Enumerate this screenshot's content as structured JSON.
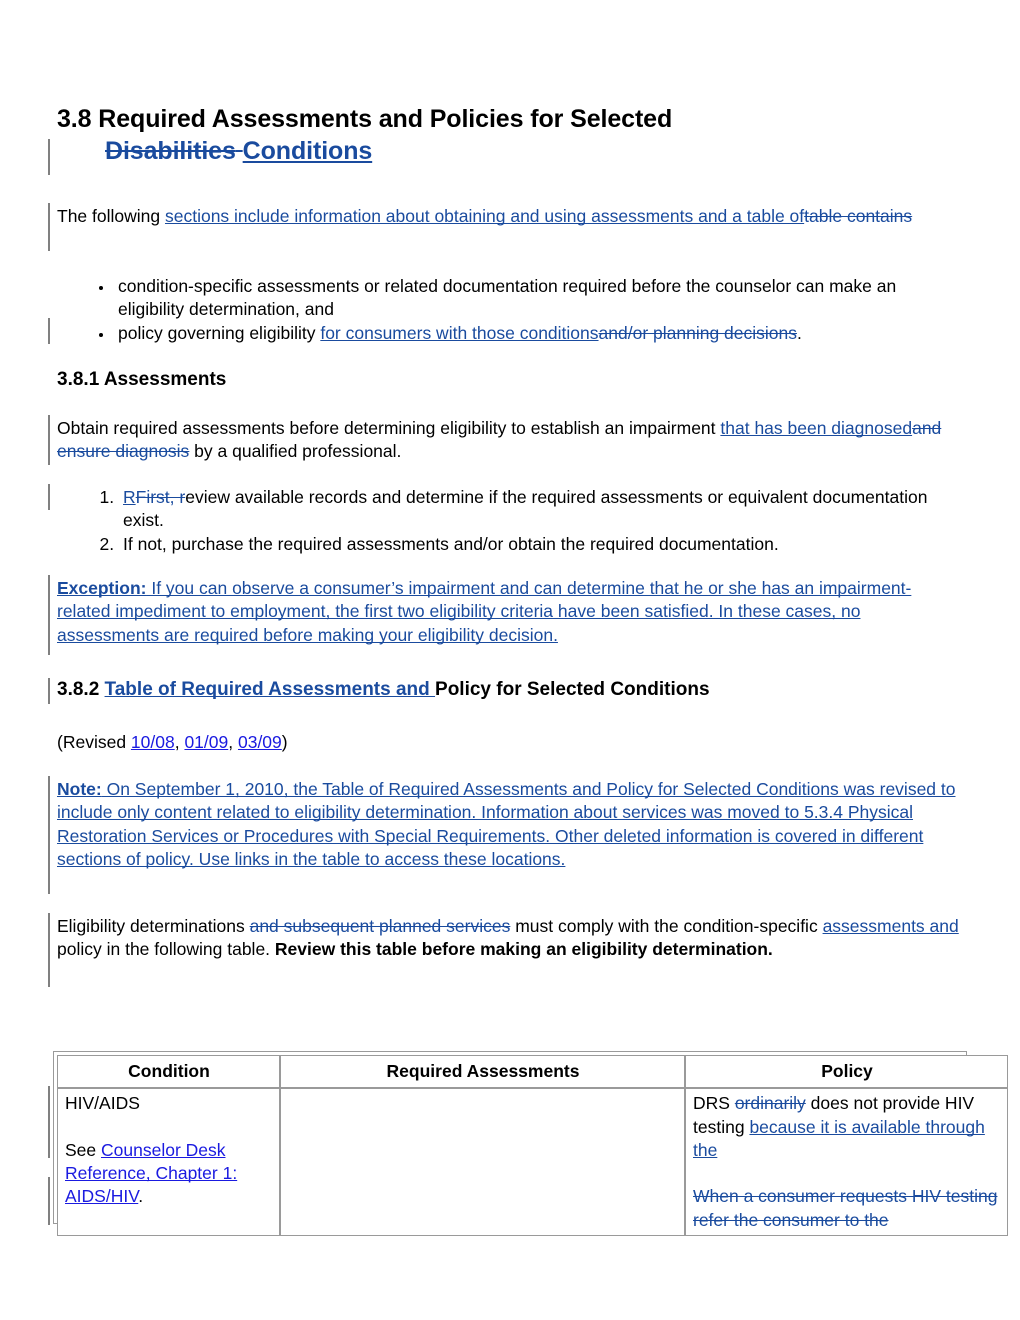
{
  "document": {
    "heading": {
      "number": "3.8",
      "line1": "3.8 Required Assessments and Policies for Selected",
      "line2_deleted": "Disabilities",
      "line2_inserted": "Conditions"
    },
    "intro": {
      "lead": "The following ",
      "inserted": "sections include information about obtaining and using assessments and a table of",
      "deleted": "table contains"
    },
    "bullets": [
      {
        "text": "condition-specific assessments or related documentation required before the counselor can make an eligibility determination, and"
      },
      {
        "lead": "policy governing eligibility ",
        "inserted": "for consumers with those conditions",
        "deleted": "and/or planning decisions",
        "tail": "."
      }
    ],
    "section_381": {
      "title": "3.8.1 Assessments",
      "paragraph": {
        "lead": "Obtain required assessments before determining eligibility to establish an impairment ",
        "inserted": "that has been diagnosed",
        "deleted": "and ensure diagnosis",
        "tail": " by a qualified professional."
      },
      "steps": [
        {
          "inserted": "R",
          "deleted": "First, r",
          "tail": "eview available records and determine if the required assessments or equivalent documentation exist."
        },
        {
          "text": "If not, purchase the required assessments and/or obtain the required documentation."
        }
      ],
      "exception": {
        "label": "Exception:",
        "text": " If you can observe a consumer’s impairment and can determine that he or she has an impairment-related impediment to employment, the first two eligibility criteria have been satisfied. In these cases, no assessments are required before making your eligibility decision."
      }
    },
    "section_382": {
      "number": "3.8.2 ",
      "inserted": "Table of Required Assessments and ",
      "tail": "Policy for Selected Conditions",
      "revised_lead": "(Revised ",
      "revised_dates": [
        "10/08",
        "01/09",
        "03/09"
      ],
      "revised_separator": ", ",
      "revised_tail": ")",
      "note": {
        "label": "Note:",
        "text": " On September 1, 2010, the Table of Required Assessments and Policy for Selected Conditions was revised to include only content related to eligibility determination. Information about services was moved to 5.3.4 Physical Restoration Services or Procedures with Special Requirements. Other deleted information is covered in different sections of policy. Use links in the table to access these locations. "
      },
      "closing": {
        "lead": "Eligibility determinations ",
        "deleted": "and subsequent planned services",
        "mid": " must comply with the condition-specific ",
        "inserted": "assessments and ",
        "tail": "policy in the following table. ",
        "bold": "Review this table before making an eligibility determination."
      }
    },
    "table": {
      "headers": [
        "Condition",
        "Required Assessments",
        "Policy"
      ],
      "rows": [
        {
          "condition": {
            "name": "HIV/AIDS",
            "see_lead": "See ",
            "link": "Counselor Desk Reference, Chapter 1: AIDS/HIV",
            "tail": "."
          },
          "assessments": "",
          "policy": {
            "lead": "DRS ",
            "deleted_word": "ordinarily",
            "mid": " does not provide HIV testing ",
            "inserted": "because it is available through the",
            "deleted_block": "When a consumer requests HIV testing refer the consumer to the"
          }
        }
      ]
    }
  },
  "colors": {
    "insertion": "#1a4b9e",
    "deletion": "#1a4b9e",
    "hyperlink": "#1a1ae0",
    "changebar": "#808080",
    "table_border": "#9a9a9a"
  }
}
